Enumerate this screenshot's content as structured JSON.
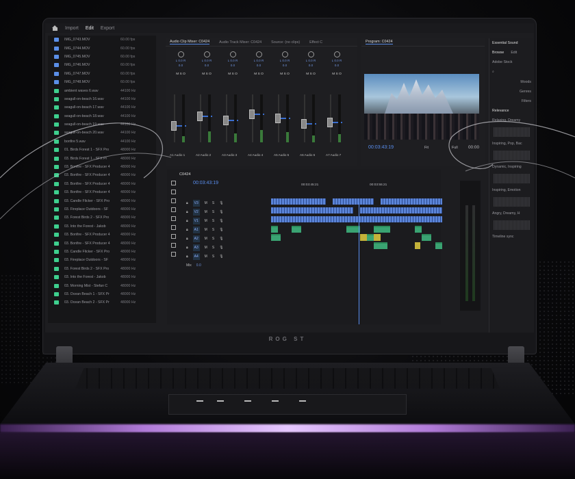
{
  "app": {
    "menu": [
      "Import",
      "Edit",
      "Export"
    ],
    "active_menu": "Edit"
  },
  "brand": "ROG ST",
  "project": {
    "rows": [
      {
        "kind": "video",
        "name": "IMG_0743.MOV",
        "rate": "60.00 fps"
      },
      {
        "kind": "video",
        "name": "IMG_0744.MOV",
        "rate": "60.00 fps"
      },
      {
        "kind": "video",
        "name": "IMG_0745.MOV",
        "rate": "60.00 fps"
      },
      {
        "kind": "video",
        "name": "IMG_0746.MOV",
        "rate": "60.00 fps"
      },
      {
        "kind": "video",
        "name": "IMG_0747.MOV",
        "rate": "60.00 fps"
      },
      {
        "kind": "video",
        "name": "IMG_0748.MOV",
        "rate": "60.00 fps"
      },
      {
        "kind": "audio",
        "name": "ambient waves 6.wav",
        "rate": "44100 Hz"
      },
      {
        "kind": "audio",
        "name": "seagull-on-beach 16.wav",
        "rate": "44100 Hz"
      },
      {
        "kind": "audio",
        "name": "seagull-on-beach 17.wav",
        "rate": "44100 Hz"
      },
      {
        "kind": "audio",
        "name": "seagull-on-beach 18.wav",
        "rate": "44100 Hz"
      },
      {
        "kind": "audio",
        "name": "seagull-on-beach 19.wav",
        "rate": "44100 Hz"
      },
      {
        "kind": "audio",
        "name": "seagull-on-beach 20.wav",
        "rate": "44100 Hz"
      },
      {
        "kind": "audio",
        "name": "bonfire 5.wav",
        "rate": "44100 Hz"
      },
      {
        "kind": "audio",
        "name": "01. Birds Forest 1 - SFX Pro",
        "rate": "48000 Hz"
      },
      {
        "kind": "audio",
        "name": "03. Birds Forest 1 - SFX Pr",
        "rate": "48000 Hz"
      },
      {
        "kind": "audio",
        "name": "03. Bonfire - SFX Producer 4",
        "rate": "48000 Hz"
      },
      {
        "kind": "audio",
        "name": "03. Bonfire - SFX Producer 4",
        "rate": "48000 Hz"
      },
      {
        "kind": "audio",
        "name": "03. Bonfire - SFX Producer 4",
        "rate": "48000 Hz"
      },
      {
        "kind": "audio",
        "name": "03. Bonfire - SFX Producer 4",
        "rate": "48000 Hz"
      },
      {
        "kind": "audio",
        "name": "03. Candle Flicker - SFX Pro",
        "rate": "48000 Hz"
      },
      {
        "kind": "audio",
        "name": "03. Fireplace Outdoors - SF",
        "rate": "48000 Hz"
      },
      {
        "kind": "audio",
        "name": "03. Forest Birds 2 - SFX Pro",
        "rate": "48000 Hz"
      },
      {
        "kind": "audio",
        "name": "03. Into the Forest - Jakob",
        "rate": "48000 Hz"
      },
      {
        "kind": "audio",
        "name": "03. Bonfire - SFX Producer 4",
        "rate": "48000 Hz"
      },
      {
        "kind": "audio",
        "name": "03. Bonfire - SFX Producer 4",
        "rate": "48000 Hz"
      },
      {
        "kind": "audio",
        "name": "03. Candle Flicker - SFX Pro",
        "rate": "48000 Hz"
      },
      {
        "kind": "audio",
        "name": "03. Fireplace Outdoors - SF",
        "rate": "48000 Hz"
      },
      {
        "kind": "audio",
        "name": "03. Forest Birds 2 - SFX Pro",
        "rate": "48000 Hz"
      },
      {
        "kind": "audio",
        "name": "03. Into the Forest - Jakob",
        "rate": "48000 Hz"
      },
      {
        "kind": "audio",
        "name": "03. Morning Mist - Stefan C",
        "rate": "48000 Hz"
      },
      {
        "kind": "audio",
        "name": "03. Ocean Beach 1 - SFX Pr",
        "rate": "48000 Hz"
      },
      {
        "kind": "audio",
        "name": "03. Ocean Beach 2 - SFX Pr",
        "rate": "48000 Hz"
      }
    ]
  },
  "mixer": {
    "tabs": [
      "Audio Clip Mixer: C0424",
      "Audio Track Mixer: C0424",
      "Source: (no clips)",
      "Effect C"
    ],
    "channels": [
      {
        "lr": "L  0.0  R",
        "db": "0.0",
        "label": "A1",
        "name": "Audio 1",
        "level": 0.3
      },
      {
        "lr": "L  0.0  R",
        "db": "0.0",
        "label": "A2",
        "name": "Audio 2",
        "level": 0.55
      },
      {
        "lr": "L  0.0  R",
        "db": "0.0",
        "label": "A3",
        "name": "Audio 3",
        "level": 0.45
      },
      {
        "lr": "L  0.0  R",
        "db": "0.0",
        "label": "A4",
        "name": "Audio 4",
        "level": 0.6
      },
      {
        "lr": "L  0.0  R",
        "db": "0.0",
        "label": "A5",
        "name": "Audio 5",
        "level": 0.5
      },
      {
        "lr": "L  0.0  R",
        "db": "0.0",
        "label": "A6",
        "name": "Audio 6",
        "level": 0.35
      },
      {
        "lr": "L  0.0  R",
        "db": "0.0",
        "label": "A7",
        "name": "Audio 7",
        "level": 0.4
      }
    ],
    "msr": "M  S  O"
  },
  "program": {
    "title": "Program: C0424",
    "timecode": "00:03:43:19",
    "fit": "Fit",
    "quality": "Full",
    "right_tc": "00:00"
  },
  "essential": {
    "title": "Essential Sound",
    "tabs": [
      "Browse",
      "Edit"
    ],
    "source": "Adobe Stock",
    "sections": [
      "Moods",
      "Genres",
      "Filters"
    ],
    "sort": "Relevance",
    "items": [
      "Relaxing, Dreamy",
      "Inspiring, Pop, Bac",
      "Dynamic, Inspiring",
      "Inspiring, Emotion",
      "Angry, Dreamy, H"
    ],
    "sync": "Timeline sync"
  },
  "timeline": {
    "title": "C0424",
    "timecode": "00:03:43:19",
    "ruler": [
      "00:03:45:21",
      "00:03:55:21"
    ],
    "tracks": [
      "V3",
      "V2",
      "V1",
      "A1",
      "A2",
      "A3",
      "A4"
    ],
    "mix_label": "Mix",
    "mix_value": "0.0"
  },
  "colors": {
    "accent": "#5b8fe8",
    "audio_clip": "#3aa372",
    "video_clip": "#5b84d8",
    "glow": "#b07ad8"
  }
}
